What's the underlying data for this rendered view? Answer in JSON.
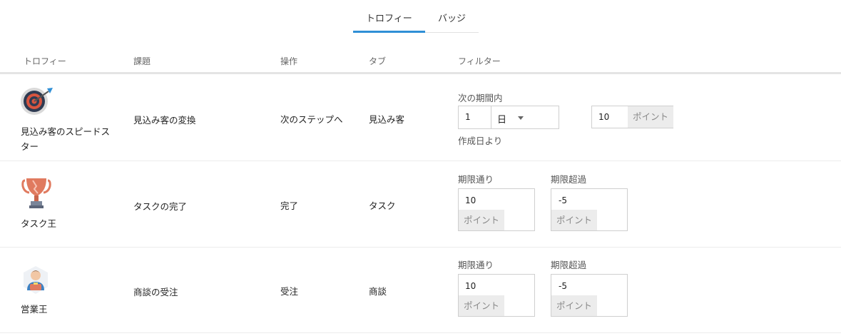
{
  "tabs": [
    {
      "label": "トロフィー",
      "active": true
    },
    {
      "label": "バッジ",
      "active": false
    }
  ],
  "table": {
    "headers": [
      "トロフィー",
      "課題",
      "操作",
      "タブ",
      "フィルター"
    ],
    "rows": [
      {
        "icon": "target-trophy-icon",
        "name": "見込み客のスピードスター",
        "task": "見込み客の変換",
        "action": "次のステップへ",
        "tab": "見込み客",
        "filter": {
          "label": "次の期間内",
          "period_value": "1",
          "period_unit": "日",
          "suffix": "作成日より",
          "points_value": "10",
          "points_label": "ポイント"
        }
      },
      {
        "icon": "cup-trophy-icon",
        "name": "タスク王",
        "task": "タスクの完了",
        "action": "完了",
        "tab": "タスク",
        "filter": {
          "ontime_label": "期限通り",
          "ontime_value": "10",
          "overdue_label": "期限超過",
          "overdue_value": "-5",
          "points_label": "ポイント"
        }
      },
      {
        "icon": "salesperson-trophy-icon",
        "name": "営業王",
        "task": "商談の受注",
        "action": "受注",
        "tab": "商談",
        "filter": {
          "ontime_label": "期限通り",
          "ontime_value": "10",
          "overdue_label": "期限超過",
          "overdue_value": "-5",
          "points_label": "ポイント"
        }
      }
    ]
  },
  "colors": {
    "accent": "#2f8fd6",
    "trophy_cup": "#e07a5f",
    "point_bg": "#ececec"
  }
}
